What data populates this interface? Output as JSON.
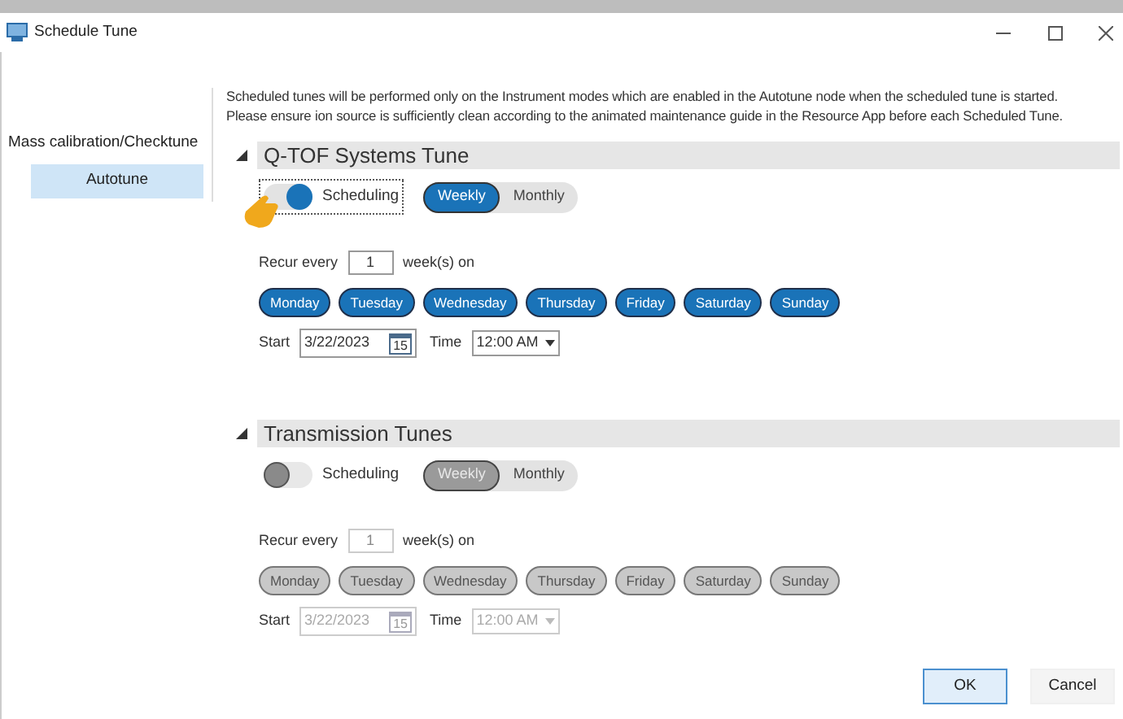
{
  "window": {
    "title": "Schedule Tune"
  },
  "sidebar": {
    "items": [
      {
        "label": "Mass calibration/Checktune",
        "selected": false
      },
      {
        "label": "Autotune",
        "selected": true
      }
    ]
  },
  "info": [
    "Scheduled tunes will be performed only on the Instrument modes which are enabled in the Autotune node when the scheduled tune is started.",
    "Please ensure ion source is sufficiently clean according to the animated maintenance guide in the Resource App before each Scheduled Tune."
  ],
  "sections": [
    {
      "title": "Q-TOF Systems Tune",
      "expanded": true,
      "scheduling": {
        "label": "Scheduling",
        "on": true,
        "focused": true
      },
      "frequency": [
        {
          "label": "Weekly",
          "selected": true
        },
        {
          "label": "Monthly",
          "selected": false
        }
      ],
      "recur_label": "Recur every",
      "recur_value": "1",
      "recur_unit": "week(s) on",
      "days": [
        {
          "label": "Monday",
          "selected": true
        },
        {
          "label": "Tuesday",
          "selected": true
        },
        {
          "label": "Wednesday",
          "selected": true
        },
        {
          "label": "Thursday",
          "selected": true
        },
        {
          "label": "Friday",
          "selected": true
        },
        {
          "label": "Saturday",
          "selected": true
        },
        {
          "label": "Sunday",
          "selected": true
        }
      ],
      "start_label": "Start",
      "start_date": "3/22/2023",
      "calendar_day": "15",
      "time_label": "Time",
      "time": "12:00 AM"
    },
    {
      "title": "Transmission Tunes",
      "expanded": true,
      "scheduling": {
        "label": "Scheduling",
        "on": false,
        "focused": false
      },
      "frequency": [
        {
          "label": "Weekly",
          "selected": true
        },
        {
          "label": "Monthly",
          "selected": false
        }
      ],
      "recur_label": "Recur every",
      "recur_value": "1",
      "recur_unit": "week(s) on",
      "days": [
        {
          "label": "Monday",
          "selected": true
        },
        {
          "label": "Tuesday",
          "selected": true
        },
        {
          "label": "Wednesday",
          "selected": true
        },
        {
          "label": "Thursday",
          "selected": true
        },
        {
          "label": "Friday",
          "selected": true
        },
        {
          "label": "Saturday",
          "selected": true
        },
        {
          "label": "Sunday",
          "selected": true
        }
      ],
      "start_label": "Start",
      "start_date": "3/22/2023",
      "calendar_day": "15",
      "time_label": "Time",
      "time": "12:00 AM"
    }
  ],
  "buttons": [
    {
      "label": "OK",
      "kind": "primary"
    },
    {
      "label": "Cancel",
      "kind": "secondary"
    }
  ]
}
